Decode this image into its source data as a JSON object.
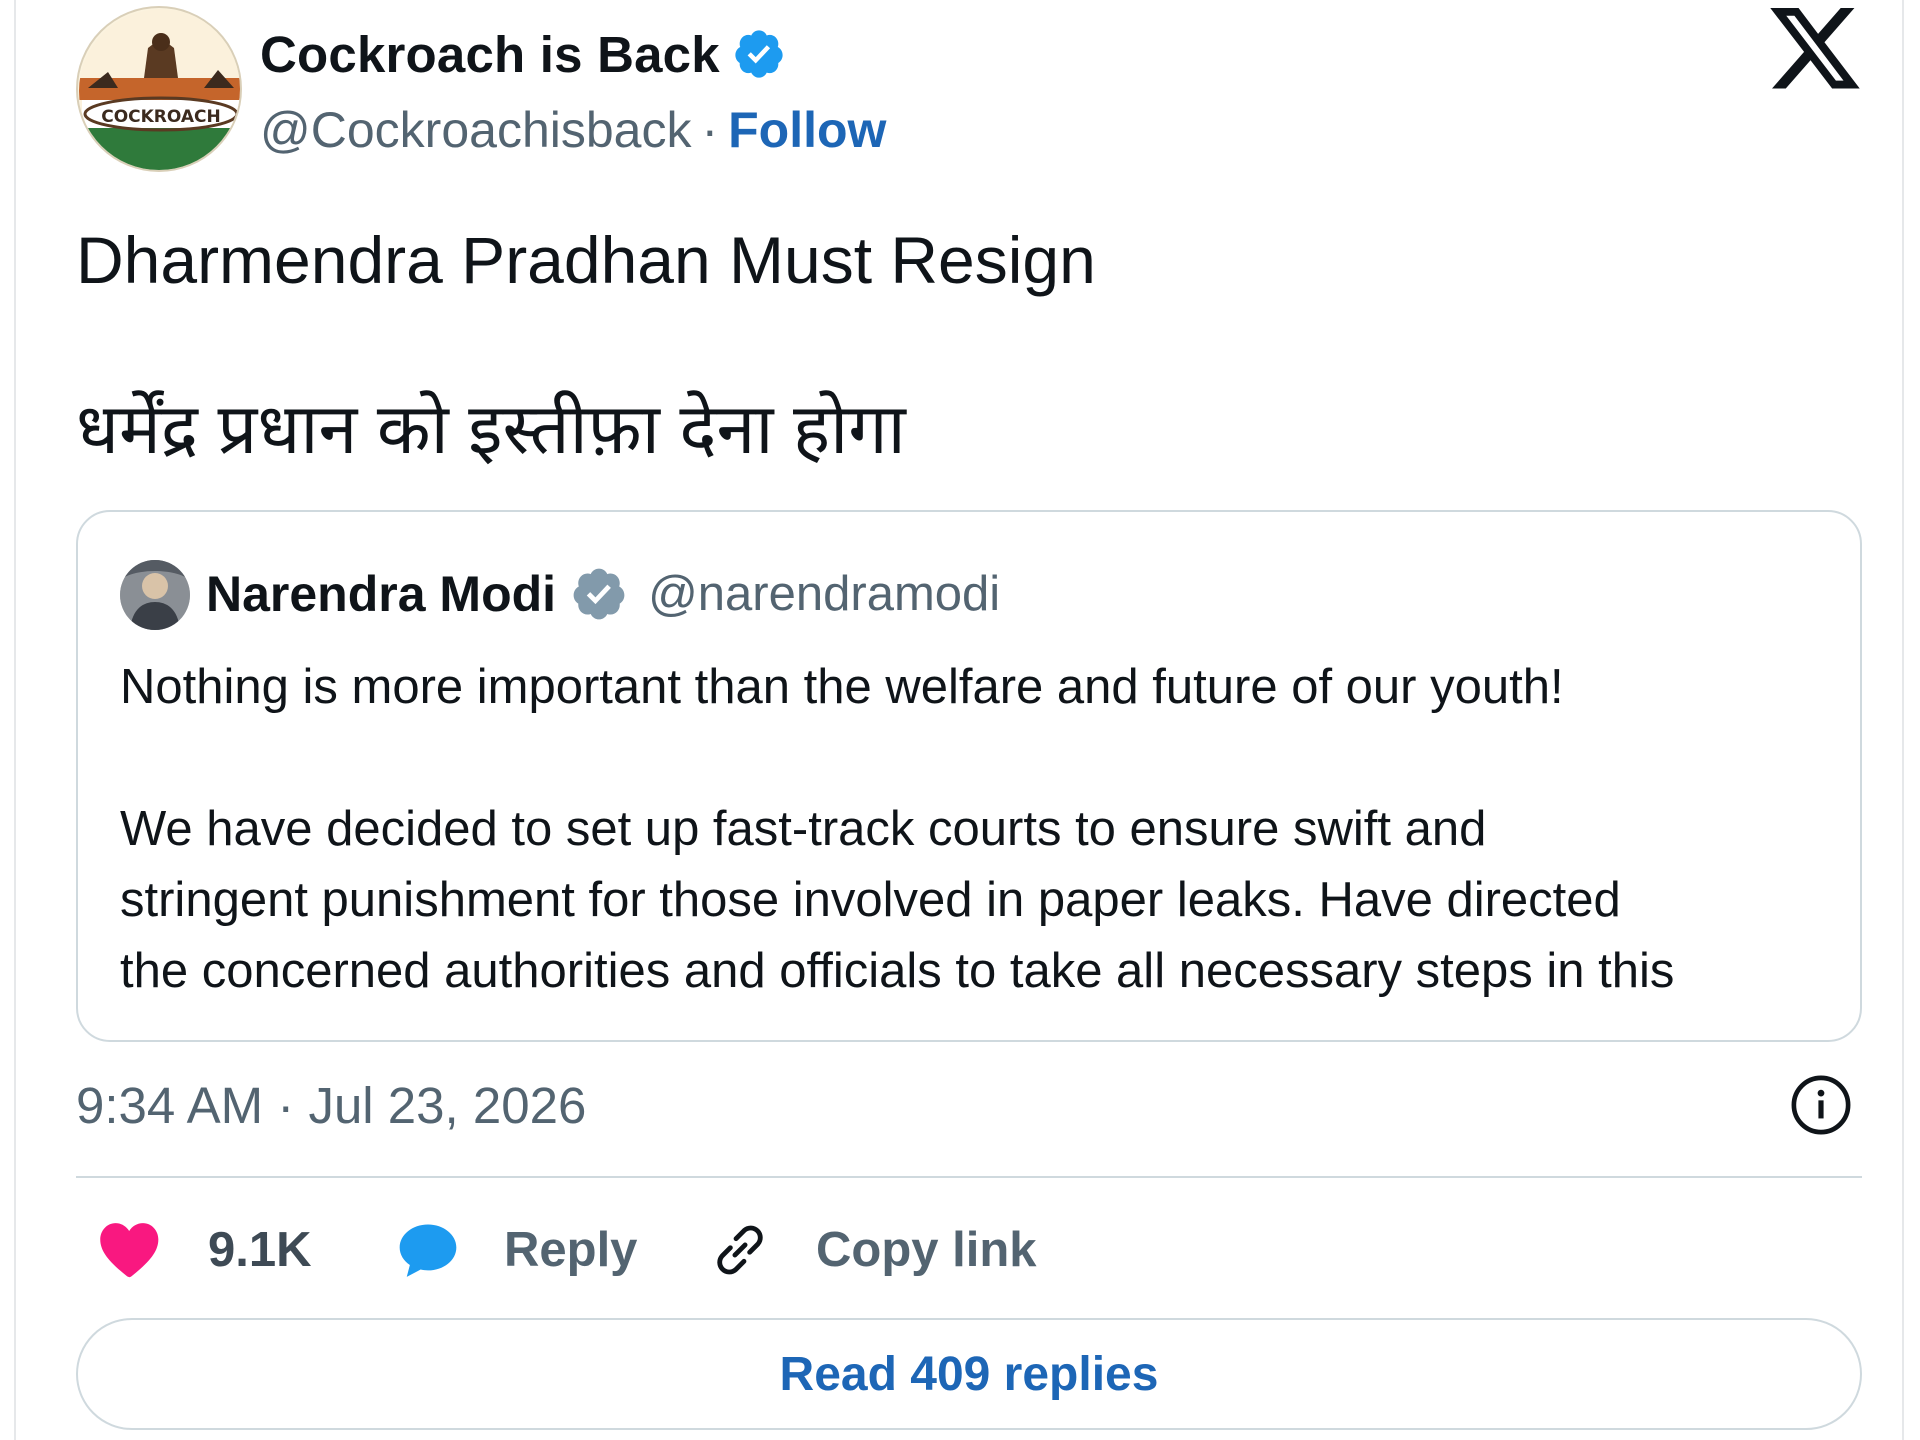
{
  "author": {
    "display_name": "Cockroach is Back",
    "handle": "@Cockroachisback",
    "separator": "·",
    "follow_label": "Follow",
    "avatar_text": "COCKROACH"
  },
  "tweet": {
    "line1": "Dharmendra Pradhan Must Resign",
    "line2": "धर्मेंद्र प्रधान को इस्तीफ़ा देना होगा"
  },
  "quoted_tweet": {
    "display_name": "Narendra Modi",
    "handle": "@narendramodi",
    "lines": [
      "Nothing is more important than the welfare and future of our youth!",
      "",
      "We have decided to set up fast-track courts to ensure swift and",
      "stringent punishment for those involved in paper leaks. Have directed",
      "the concerned authorities and officials to take all necessary steps in this"
    ]
  },
  "meta": {
    "timestamp": "9:34 AM · Jul 23, 2026"
  },
  "actions": {
    "likes": "9.1K",
    "reply_label": "Reply",
    "copy_link_label": "Copy link"
  },
  "read_replies_label": "Read 409 replies",
  "colors": {
    "link_blue": "#1d66b6",
    "verified_blue": "#1d9bf0",
    "verified_grey": "#829aab",
    "heart_pink": "#f91880",
    "reply_blue": "#1d9bf0"
  },
  "icons": [
    "verified-icon",
    "x-logo-icon",
    "info-icon",
    "heart-icon",
    "reply-bubble-icon",
    "link-icon"
  ]
}
